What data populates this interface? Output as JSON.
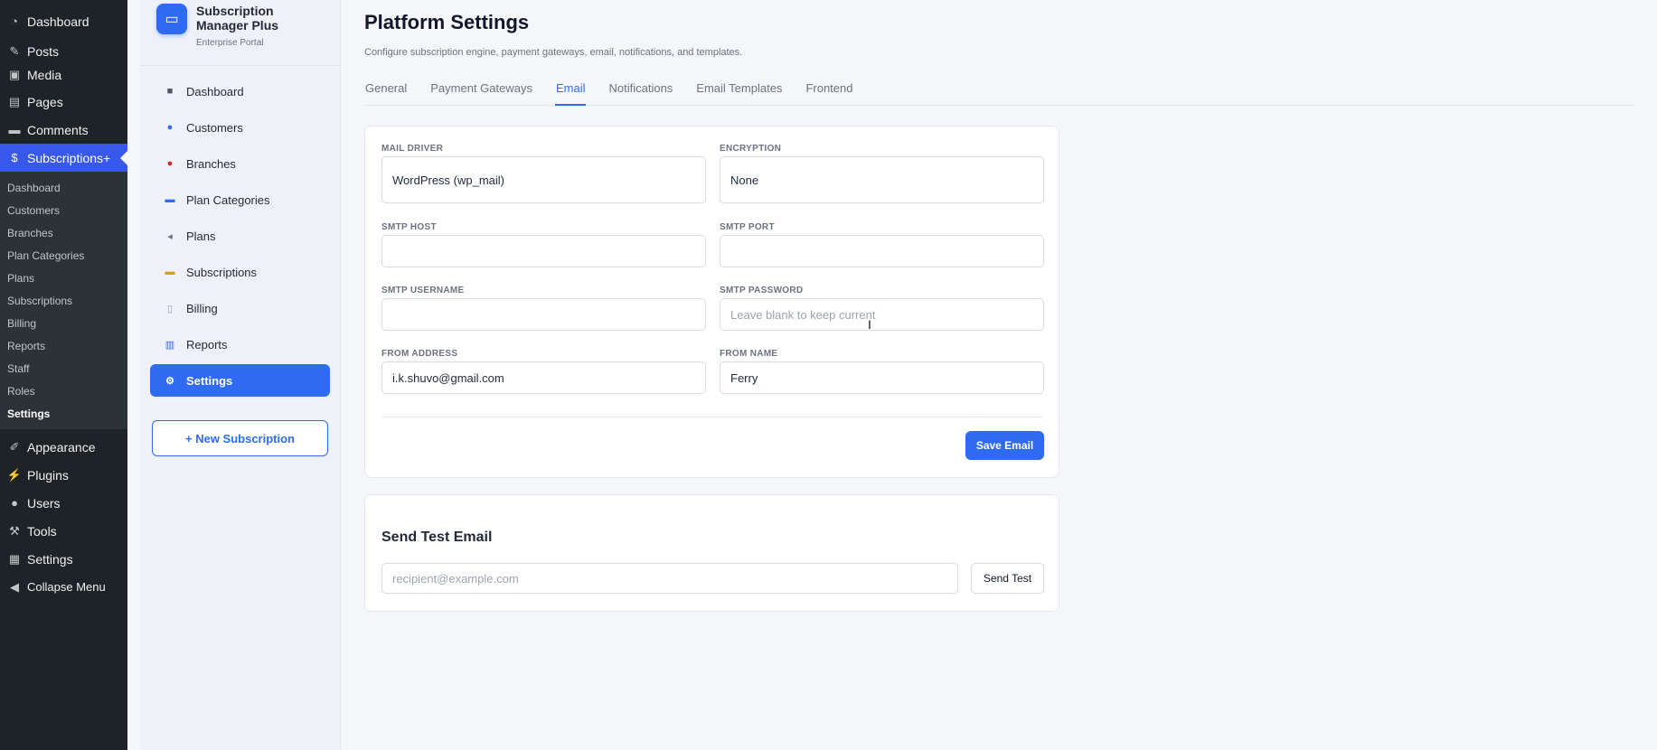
{
  "wp_menu": {
    "top_items": [
      {
        "label": "Dashboard",
        "icon": "dashboard-icon"
      },
      {
        "label": "Posts",
        "icon": "pin-icon"
      },
      {
        "label": "Media",
        "icon": "media-icon"
      },
      {
        "label": "Pages",
        "icon": "pages-icon"
      },
      {
        "label": "Comments",
        "icon": "comments-icon"
      },
      {
        "label": "Subscriptions+",
        "icon": "dollar-icon"
      }
    ],
    "sub_items": [
      "Dashboard",
      "Customers",
      "Branches",
      "Plan Categories",
      "Plans",
      "Subscriptions",
      "Billing",
      "Reports",
      "Staff",
      "Roles",
      "Settings"
    ],
    "bottom_items": [
      {
        "label": "Appearance",
        "icon": "brush-icon"
      },
      {
        "label": "Plugins",
        "icon": "plug-icon"
      },
      {
        "label": "Users",
        "icon": "user-icon"
      },
      {
        "label": "Tools",
        "icon": "wrench-icon"
      },
      {
        "label": "Settings",
        "icon": "settings-icon"
      },
      {
        "label": "Collapse Menu",
        "icon": "collapse-icon"
      }
    ]
  },
  "plugin": {
    "title": "Subscription Manager Plus",
    "subtitle": "Enterprise Portal",
    "nav": [
      {
        "label": "Dashboard",
        "icon": "grid-icon"
      },
      {
        "label": "Customers",
        "icon": "users-icon"
      },
      {
        "label": "Branches",
        "icon": "pin-icon"
      },
      {
        "label": "Plan Categories",
        "icon": "folder-icon"
      },
      {
        "label": "Plans",
        "icon": "tag-icon"
      },
      {
        "label": "Subscriptions",
        "icon": "card-icon"
      },
      {
        "label": "Billing",
        "icon": "receipt-icon"
      },
      {
        "label": "Reports",
        "icon": "chart-icon"
      },
      {
        "label": "Settings",
        "icon": "gear-icon"
      }
    ],
    "new_button": "+  New Subscription"
  },
  "page": {
    "title": "Platform Settings",
    "subtitle": "Configure subscription engine, payment gateways, email, notifications, and templates.",
    "tabs": [
      "General",
      "Payment Gateways",
      "Email",
      "Notifications",
      "Email Templates",
      "Frontend"
    ],
    "active_tab": "Email"
  },
  "email_form": {
    "mail_driver": {
      "label": "MAIL DRIVER",
      "value": "WordPress (wp_mail)"
    },
    "encryption": {
      "label": "ENCRYPTION",
      "value": "None"
    },
    "smtp_host": {
      "label": "SMTP HOST",
      "value": ""
    },
    "smtp_port": {
      "label": "SMTP PORT",
      "value": ""
    },
    "smtp_username": {
      "label": "SMTP USERNAME",
      "value": ""
    },
    "smtp_password": {
      "label": "SMTP PASSWORD",
      "placeholder": "Leave blank to keep current"
    },
    "from_address": {
      "label": "FROM ADDRESS",
      "value": "i.k.shuvo@gmail.com"
    },
    "from_name": {
      "label": "FROM NAME",
      "value": "Ferry"
    },
    "save_label": "Save Email"
  },
  "test_email": {
    "title": "Send Test Email",
    "placeholder": "recipient@example.com",
    "button": "Send Test"
  },
  "colors": {
    "accent": "#2f6bf0",
    "wp_dark": "#1d2327",
    "wp_highlight": "#3858e9"
  }
}
